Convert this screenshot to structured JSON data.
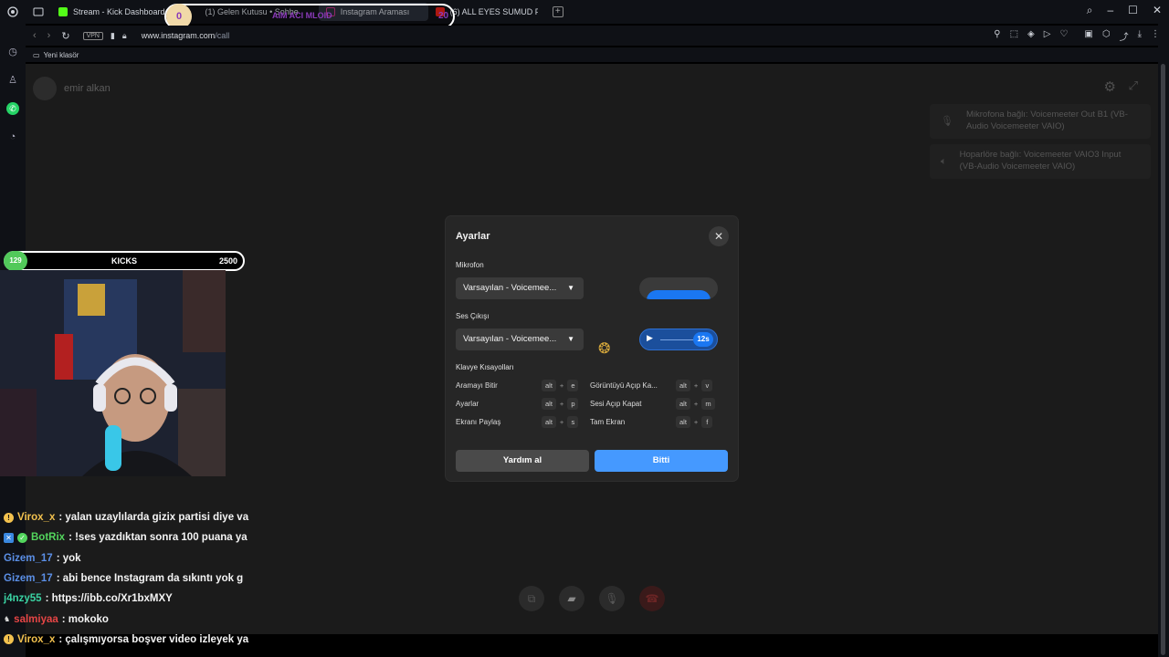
{
  "browser": {
    "tabs": [
      {
        "label": "Stream - Kick Dashboard",
        "color": "#53fc18"
      },
      {
        "label": "(1) Gelen Kutusu • Sohbe",
        "color": "#c13584"
      },
      {
        "label": "Instagram Araması",
        "color": "#c13584",
        "active": true
      },
      {
        "label": "(6) ALL EYES SUMUD FLO",
        "color": "#ff0000"
      }
    ],
    "url_host": "www.instagram.com",
    "url_path": "/call",
    "vpn_label": "VPN",
    "bookmark_folder": "Yeni klasör"
  },
  "overlay_pill": {
    "left_value": "0",
    "mid_text": "AIM ACI MLOID",
    "right_value": "20"
  },
  "call": {
    "callee_name": "emir alkan",
    "notices": [
      "Mikrofona bağlı: Voicemeeter Out B1 (VB-Audio Voicemeeter VAIO)",
      "Hoparlöre bağlı: Voicemeeter VAIO3 Input (VB-Audio Voicemeeter VAIO)"
    ]
  },
  "dialog": {
    "title": "Ayarlar",
    "mic_label": "Mikrofon",
    "mic_value": "Varsayılan - Voicemee...",
    "output_label": "Ses Çıkışı",
    "output_value": "Varsayılan - Voicemee...",
    "test_time": "12s",
    "shortcuts_label": "Klavye Kısayolları",
    "shortcuts": [
      {
        "name": "Aramayı Bitir",
        "mod": "alt",
        "key": "e"
      },
      {
        "name": "Ayarlar",
        "mod": "alt",
        "key": "p"
      },
      {
        "name": "Ekranı Paylaş",
        "mod": "alt",
        "key": "s"
      },
      {
        "name": "Görüntüyü Açıp Ka...",
        "mod": "alt",
        "key": "v"
      },
      {
        "name": "Sesi Açıp Kapat",
        "mod": "alt",
        "key": "m"
      },
      {
        "name": "Tam Ekran",
        "mod": "alt",
        "key": "f"
      }
    ],
    "plus": "+",
    "help_button": "Yardım al",
    "done_button": "Bitti"
  },
  "kicks": {
    "badge": "129",
    "label": "KICKS",
    "value": "2500"
  },
  "chat": [
    {
      "user": "Virox_x",
      "text": ": yalan uzaylılarda gizix partisi diye va",
      "color": "yellow"
    },
    {
      "user": "BotRix",
      "text": ": !ses yazdıktan sonra 100 puana ya",
      "color": "green"
    },
    {
      "user": "Gizem_17",
      "text": ": yok",
      "color": "blue"
    },
    {
      "user": "Gizem_17",
      "text": ": abi bence Instagram da sıkıntı yok g",
      "color": "blue"
    },
    {
      "user": "j4nzy55",
      "text": ": https://ibb.co/Xr1bxMXY",
      "color": "teal"
    },
    {
      "user": "salmiyaa",
      "text": ": mokoko",
      "color": "red"
    },
    {
      "user": "Virox_x",
      "text": ": çalışmıyorsa boşver video izleyek ya",
      "color": "yellow"
    }
  ]
}
